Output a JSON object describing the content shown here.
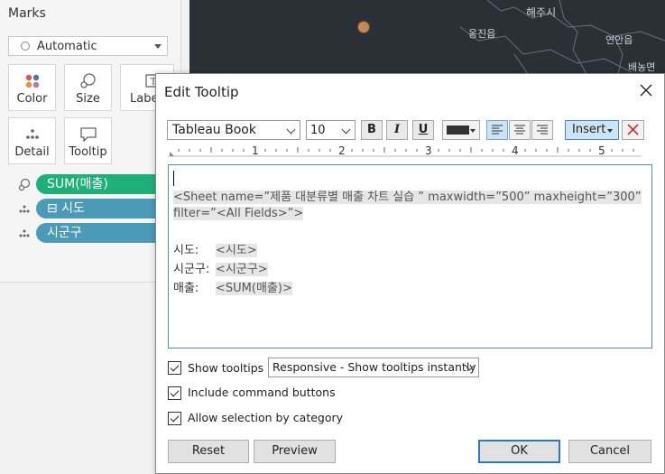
{
  "marks": {
    "title": "Marks",
    "mark_type": "Automatic",
    "cards": [
      {
        "label": "Color",
        "icon": "color-icon"
      },
      {
        "label": "Size",
        "icon": "size-icon"
      },
      {
        "label": "Label",
        "icon": "label-icon"
      },
      {
        "label": "Detail",
        "icon": "detail-icon"
      },
      {
        "label": "Tooltip",
        "icon": "tooltip-icon"
      }
    ],
    "pills": [
      {
        "label": "SUM(매출)",
        "icon": "size-icon",
        "color": "#1fb07a"
      },
      {
        "label": "⊟ 시도",
        "icon": "detail-icon",
        "color": "#4a9ab8"
      },
      {
        "label": "시군구",
        "icon": "detail-icon",
        "color": "#4a9ab8"
      }
    ]
  },
  "map": {
    "labels": [
      "해주시",
      "옹진읍",
      "연안읍",
      "배농면"
    ]
  },
  "dialog": {
    "title": "Edit Tooltip",
    "font": "Tableau Book",
    "font_size": "10",
    "bold": "B",
    "italic": "I",
    "underline": "U",
    "insert": "Insert",
    "ruler": [
      "1",
      "2",
      "3",
      "4",
      "5"
    ],
    "editor": {
      "line1_field": "<Sheet name=”제품 대분류별 매출 차트 실습 ” maxwidth=”500” maxheight=”300”",
      "line2_field": "filter=”<All Fields>”>",
      "rows": [
        {
          "label": "시도:",
          "field": "<시도>"
        },
        {
          "label": "시군구:",
          "field": "<시군구>"
        },
        {
          "label": "매출:",
          "field": "<SUM(매출)>"
        }
      ]
    },
    "options": {
      "show_tooltips": "Show tooltips",
      "tooltip_mode": "Responsive - Show tooltips instantly",
      "include_buttons": "Include command buttons",
      "allow_selection": "Allow selection by category"
    },
    "buttons": {
      "reset": "Reset",
      "preview": "Preview",
      "ok": "OK",
      "cancel": "Cancel"
    }
  }
}
